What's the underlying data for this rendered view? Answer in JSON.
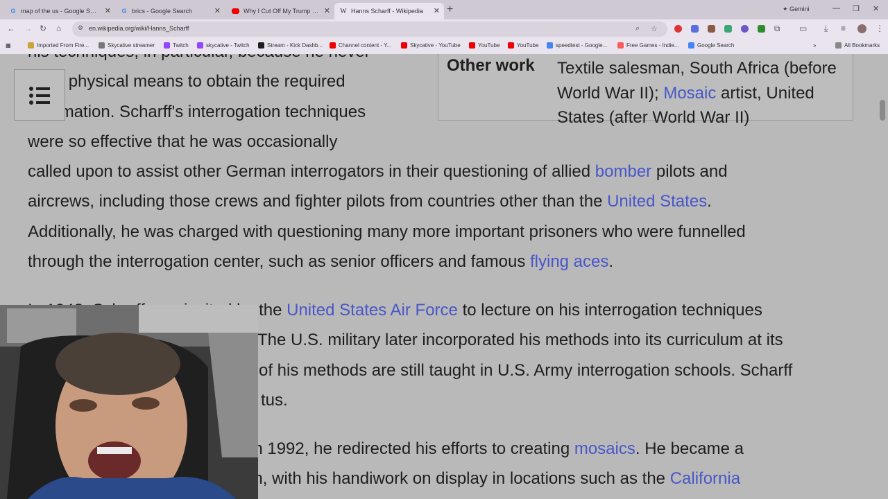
{
  "tabs": [
    {
      "title": "map of the us - Google Search",
      "icon": "google-icon",
      "active": false
    },
    {
      "title": "brics - Google Search",
      "icon": "google-icon",
      "active": false
    },
    {
      "title": "Why I Cut Off My Trump Voting",
      "icon": "youtube-icon",
      "active": false
    },
    {
      "title": "Hanns Scharff - Wikipedia",
      "icon": "wikipedia-icon",
      "active": true
    }
  ],
  "gemini_label": "Gemini",
  "address": "en.wikipedia.org/wiki/Hanns_Scharff",
  "bookmarks": [
    "Imported From Fire...",
    "Skycative streamer",
    "Twitch",
    "skycative - Twitch",
    "Stream - Kick Dashb...",
    "Channel content - Y...",
    "Skycative - YouTube",
    "YouTube",
    "YouTube",
    "speedtest - Google...",
    "Free Games - Indie...",
    "Google Search"
  ],
  "all_bookmarks": "All Bookmarks",
  "article": {
    "p1_line0": "his techniques, in particular, because he never",
    "p1_line1a": "used physical means to obtain the required",
    "p1_line2a": "information. Scharff's interrogation techniques",
    "p1_line3": "were so effective that he was occasionally",
    "p1_line4a": "called upon to assist other German interrogators in their questioning of allied ",
    "p1_link_bomber": "bomber",
    "p1_line4b": " pilots and",
    "p1_line5a": "aircrews, including those crews and fighter pilots from countries other than the ",
    "p1_link_us": "United States",
    "p1_line5b": ".",
    "p1_line6": "Additionally, he was charged with questioning many more important prisoners who were funnelled",
    "p1_line7a": "through the interrogation center, such as senior officers and famous ",
    "p1_link_aces": "flying aces",
    "p1_line7b": ".",
    "p2_line0a": "In 1948, Scharff was invited by the ",
    "p2_link_usaf": "United States Air Force",
    "p2_line0b": " to lecture on his interrogation techniques",
    "p2_line1": "The U.S. military later incorporated his methods into its curriculum at its",
    "p2_line2": "of his methods are still taught in U.S. Army interrogation schools. Scharff",
    "p2_line3": "tus.",
    "p3_line0a": "d in 1992, he redirected his efforts to creating ",
    "p3_link_mosaics": "mosaics",
    "p3_line0b": ". He became a",
    "p3_line1a": "san, with his handiwork on display in locations such as the ",
    "p3_link_california": "California"
  },
  "infobox": {
    "label": "Other work",
    "value_a": "Textile salesman, South Africa (before World War II); ",
    "value_link": "Mosaic",
    "value_b": " artist, United States (after World War II)"
  },
  "colors": {
    "link": "#4857c8",
    "page_bg": "#b9b9b9",
    "text": "#1e1e1e"
  }
}
